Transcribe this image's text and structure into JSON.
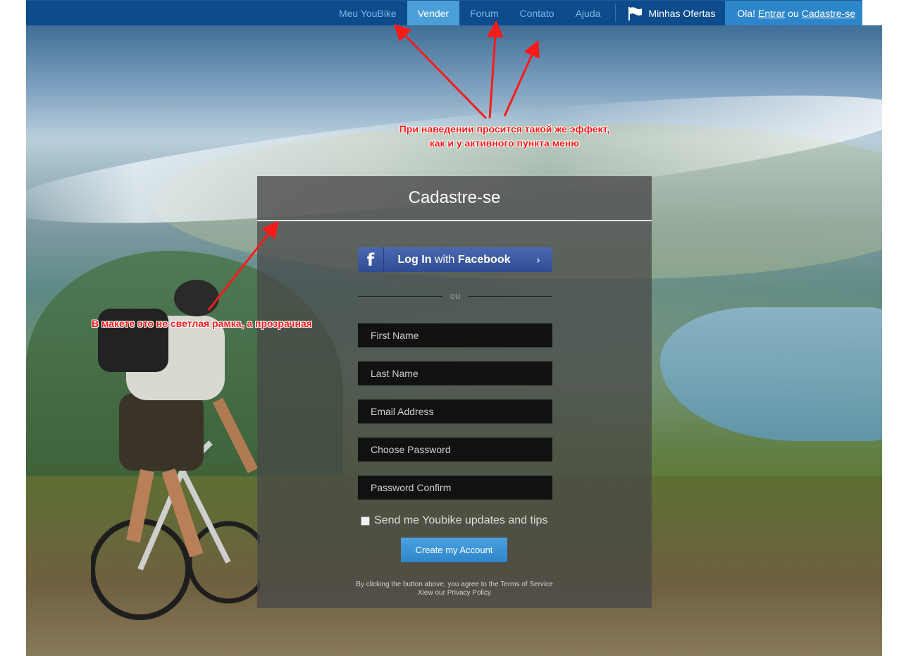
{
  "nav": {
    "items": [
      {
        "label": "Meu YouBike",
        "active": false
      },
      {
        "label": "Vender",
        "active": true
      },
      {
        "label": "Forum",
        "active": false
      },
      {
        "label": "Contato",
        "active": false
      },
      {
        "label": "Ajuda",
        "active": false
      }
    ],
    "offers_icon": "flag-icon",
    "offers_label": "Minhas Ofertas",
    "greeting": "Ola!",
    "login_link": "Entrar",
    "or_text": "ou",
    "signup_link": "Cadastre-se"
  },
  "panel": {
    "title": "Cadastre-se",
    "facebook": {
      "icon": "facebook-icon",
      "prefix": "Log In",
      "middle": " with ",
      "brand": "Facebook",
      "arrow_icon": "chevron-right-icon"
    },
    "divider_text": "ou",
    "fields": {
      "first_name": "First Name",
      "last_name": "Last Name",
      "email": "Email Address",
      "password": "Choose Password",
      "password_confirm": "Password Confirm"
    },
    "newsletter_label": "Send me Youbike updates and tips",
    "newsletter_checked": false,
    "submit_label": "Create my Account",
    "terms_line1": "By clicking the button above, you agree to the Terms of Service",
    "terms_line2": "Xiew our Privacy Policy"
  },
  "annotations": {
    "hover_note_line1": "При наведении просится такой же эффект,",
    "hover_note_line2": "как и у активного пункта меню",
    "border_note": "В макете это не светлая рамка, а прозрачная"
  },
  "colors": {
    "nav_bg": "#0c4b8c",
    "nav_active": "#4a9fd8",
    "nav_link": "#7fb6e8",
    "auth_bg": "#2d86c9",
    "facebook": "#3b5998",
    "submit": "#3a95d8",
    "annotation": "#ff1a1a"
  }
}
